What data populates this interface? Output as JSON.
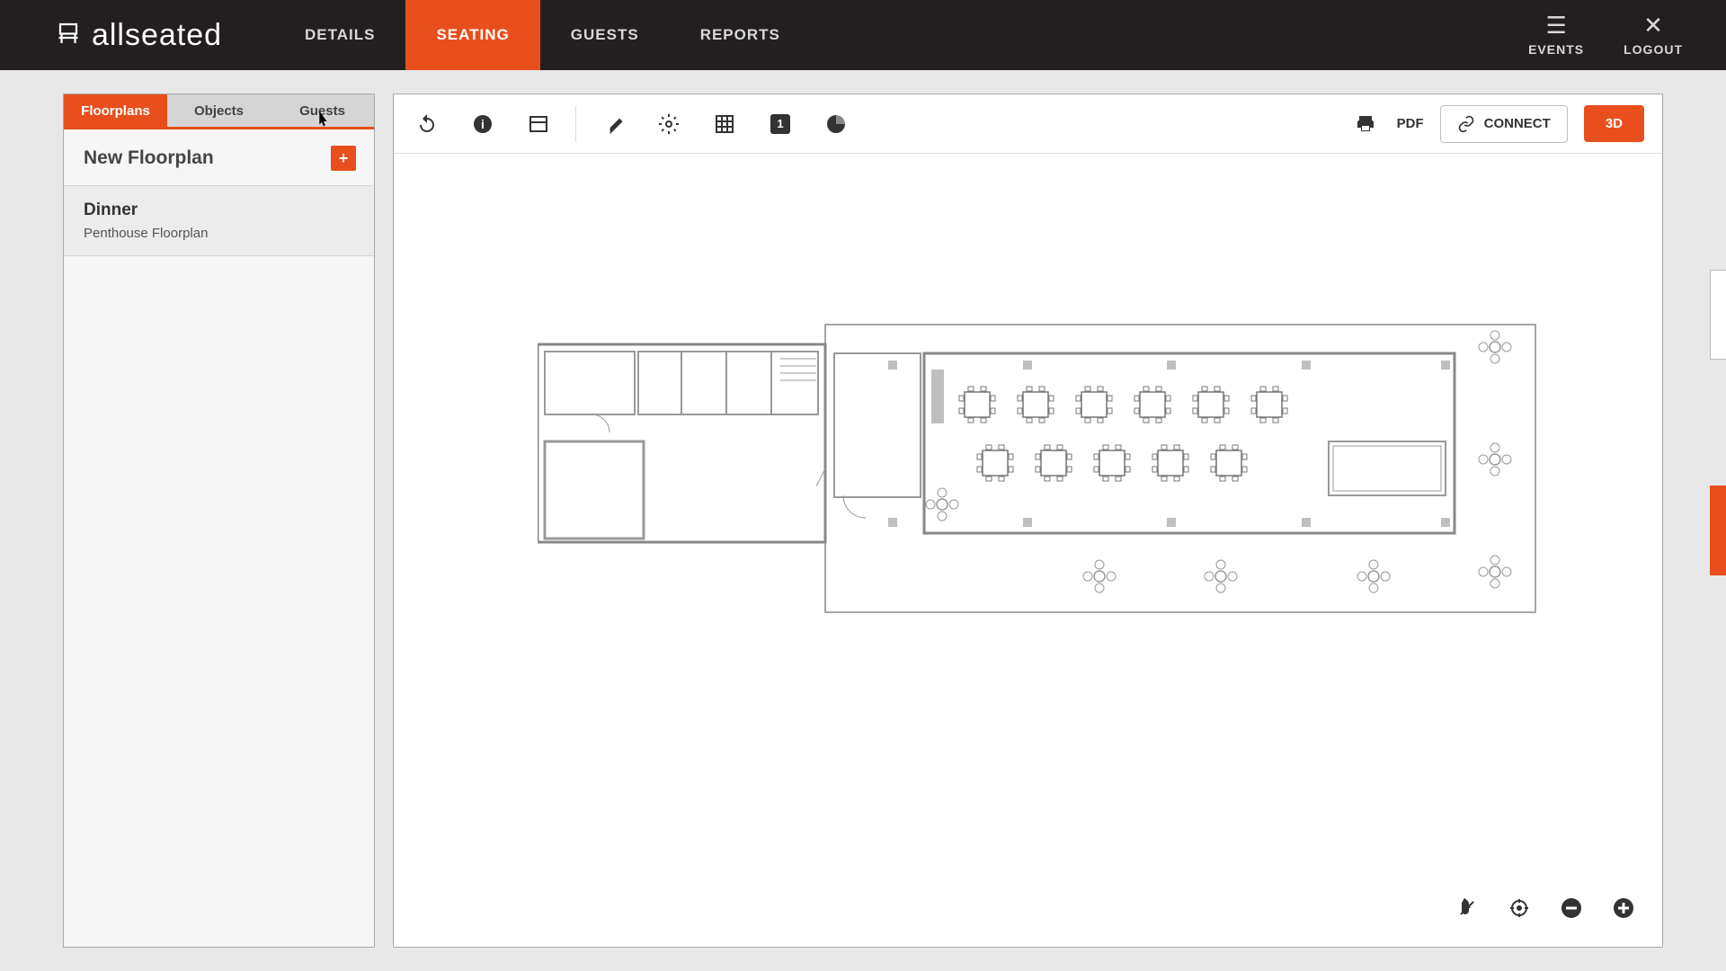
{
  "brand": "allseated",
  "nav": {
    "items": [
      {
        "label": "DETAILS",
        "active": false
      },
      {
        "label": "SEATING",
        "active": true
      },
      {
        "label": "GUESTS",
        "active": false
      },
      {
        "label": "REPORTS",
        "active": false
      }
    ],
    "right": [
      {
        "label": "EVENTS"
      },
      {
        "label": "LOGOUT"
      }
    ]
  },
  "sidebar": {
    "tabs": [
      {
        "label": "Floorplans",
        "active": true
      },
      {
        "label": "Objects",
        "active": false
      },
      {
        "label": "Guests",
        "active": false
      }
    ],
    "header": "New Floorplan",
    "floorplans": [
      {
        "name": "Dinner",
        "sub": "Penthouse Floorplan"
      }
    ]
  },
  "toolbar": {
    "number_badge": "1",
    "pdf": "PDF",
    "connect": "CONNECT",
    "threeD": "3D"
  }
}
